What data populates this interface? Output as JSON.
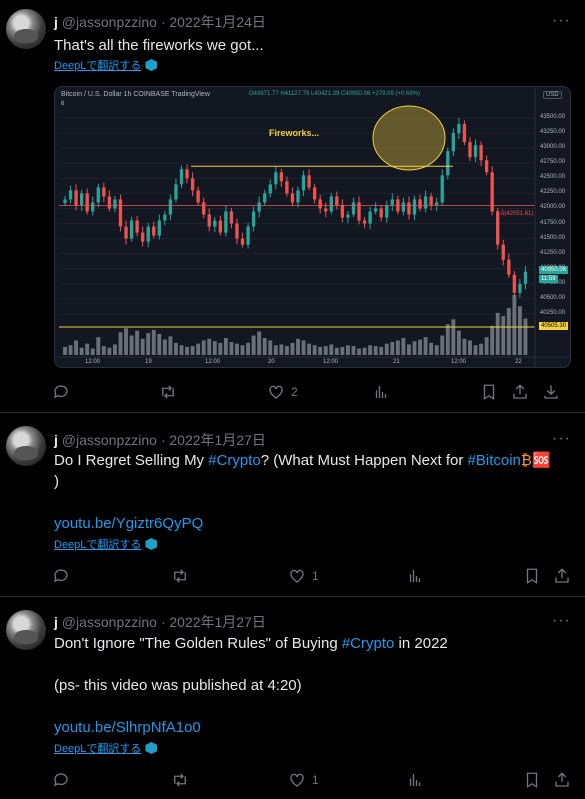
{
  "tweets": [
    {
      "name": "j",
      "handle": "@jassonpzzino",
      "date": "· 2022年1月24日",
      "lines": [
        "That's all the fireworks we got..."
      ],
      "translate": "DeepLで翻訳する",
      "reply_count": "",
      "retweet_count": "",
      "like_count": "2"
    },
    {
      "name": "j",
      "handle": "@jassonpzzino",
      "date": "· 2022年1月27日",
      "line1_pre": "Do I Regret Selling My ",
      "line1_tag1": "#Crypto",
      "line1_mid": "? (What Must Happen Next for ",
      "line1_tag2": "#Bitcoin",
      "line1_emoji": "₿🆘",
      "line2": ")",
      "url": "youtu.be/Ygiztr6QyPQ",
      "translate": "DeepLで翻訳する",
      "like_count": "1"
    },
    {
      "name": "j",
      "handle": "@jassonpzzino",
      "date": "· 2022年1月27日",
      "line1_pre": "Don't Ignore \"The Golden Rules\" of Buying ",
      "line1_tag": "#Crypto",
      "line1_post": " in 2022",
      "line2": "(ps- this video was published at 4:20)",
      "url": "youtu.be/SlhrpNfA1o0",
      "translate": "DeepLで翻訳する",
      "like_count": "1"
    }
  ],
  "icons": [
    "more-icon",
    "reply-icon",
    "retweet-icon",
    "like-icon",
    "analytics-icon",
    "bookmark-icon",
    "share-icon",
    "download-icon",
    "deepl-icon"
  ],
  "colors": {
    "link": "#1d9bf0",
    "muted": "#71767b",
    "chart_bg": "#131722",
    "up": "#26a69a",
    "down": "#ef5350"
  },
  "chart_data": {
    "type": "candlestick",
    "title": "Bitcoin / U.S. Dollar  1h  COINBASE  TradingView",
    "ohlc_text": "O43671.77 H41127.79 L40421.39 C40950.06 +279.09 (+0.69%)",
    "indicator": "6",
    "annotation": "Fireworks...",
    "hline_label": "0.5(42051.61)",
    "currency": "USD",
    "y_ticks": [
      "43500.00",
      "43250.00",
      "43000.00",
      "42750.00",
      "42500.00",
      "42250.00",
      "42000.00",
      "41750.00",
      "41500.00",
      "41250.00",
      "41000.00",
      "40750.00",
      "40500.00",
      "40250.00"
    ],
    "x_ticks": [
      "12:00",
      "19",
      "12:00",
      "20",
      "12:00",
      "21",
      "12:00",
      "22"
    ],
    "ylim": [
      40100,
      43650
    ],
    "price_tag_current": "40950.06",
    "price_tag_time": "11:59",
    "price_tag_support": "40505.30",
    "resistance": 42700,
    "support": 40505.3,
    "fib_level": 42051.61,
    "closes": [
      42150,
      42300,
      42050,
      42250,
      41950,
      42100,
      42350,
      42200,
      42000,
      42150,
      41700,
      41500,
      41800,
      41600,
      41450,
      41700,
      41550,
      41800,
      41900,
      42150,
      42400,
      42650,
      42500,
      42300,
      42100,
      41900,
      41700,
      41800,
      41600,
      41950,
      41750,
      41500,
      41400,
      41700,
      41950,
      42100,
      42250,
      42400,
      42600,
      42450,
      42250,
      42100,
      42300,
      42550,
      42350,
      42150,
      42000,
      41950,
      42200,
      42050,
      41850,
      41900,
      42100,
      41800,
      41750,
      41950,
      42000,
      41850,
      42050,
      42150,
      41950,
      42100,
      41900,
      42150,
      42000,
      42200,
      42050,
      42100,
      42550,
      42950,
      43250,
      43400,
      43100,
      42850,
      43050,
      42800,
      42600,
      41950,
      41400,
      41150,
      40900,
      40600,
      40750,
      40950
    ],
    "volumes": [
      10,
      12,
      18,
      9,
      14,
      8,
      22,
      11,
      9,
      13,
      28,
      33,
      24,
      30,
      20,
      27,
      31,
      26,
      19,
      23,
      15,
      12,
      10,
      11,
      14,
      18,
      20,
      17,
      15,
      21,
      16,
      14,
      12,
      15,
      24,
      29,
      21,
      18,
      12,
      13,
      11,
      15,
      20,
      18,
      14,
      12,
      10,
      11,
      13,
      9,
      10,
      12,
      11,
      8,
      9,
      12,
      11,
      10,
      14,
      16,
      18,
      21,
      13,
      17,
      19,
      22,
      15,
      12,
      24,
      38,
      44,
      30,
      20,
      18,
      12,
      14,
      22,
      36,
      52,
      48,
      58,
      74,
      60,
      45
    ]
  }
}
